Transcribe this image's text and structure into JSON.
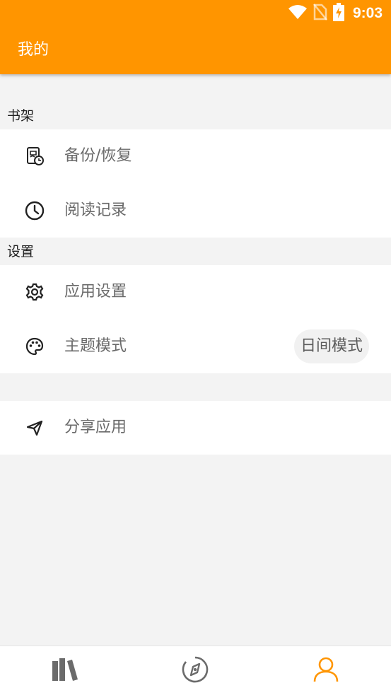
{
  "status_bar": {
    "time": "9:03",
    "icons": [
      "wifi-icon",
      "no-sim-icon",
      "battery-charging-icon"
    ]
  },
  "app_bar": {
    "title": "我的",
    "color": "#ff9500"
  },
  "sections": {
    "bookshelf": {
      "header": "书架",
      "items": [
        {
          "label": "备份/恢复",
          "icon": "backup-restore-icon"
        },
        {
          "label": "阅读记录",
          "icon": "clock-icon"
        }
      ]
    },
    "settings": {
      "header": "设置",
      "items": [
        {
          "label": "应用设置",
          "icon": "gear-icon"
        },
        {
          "label": "主题模式",
          "icon": "palette-icon",
          "value": "日间模式"
        }
      ]
    },
    "other": {
      "items": [
        {
          "label": "分享应用",
          "icon": "send-icon"
        }
      ]
    }
  },
  "bottom_nav": {
    "items": [
      {
        "icon": "bookshelf-icon",
        "active": false
      },
      {
        "icon": "compass-icon",
        "active": false
      },
      {
        "icon": "person-icon",
        "active": true
      }
    ],
    "active_color": "#ff9500",
    "inactive_color": "#6b6b6b"
  }
}
